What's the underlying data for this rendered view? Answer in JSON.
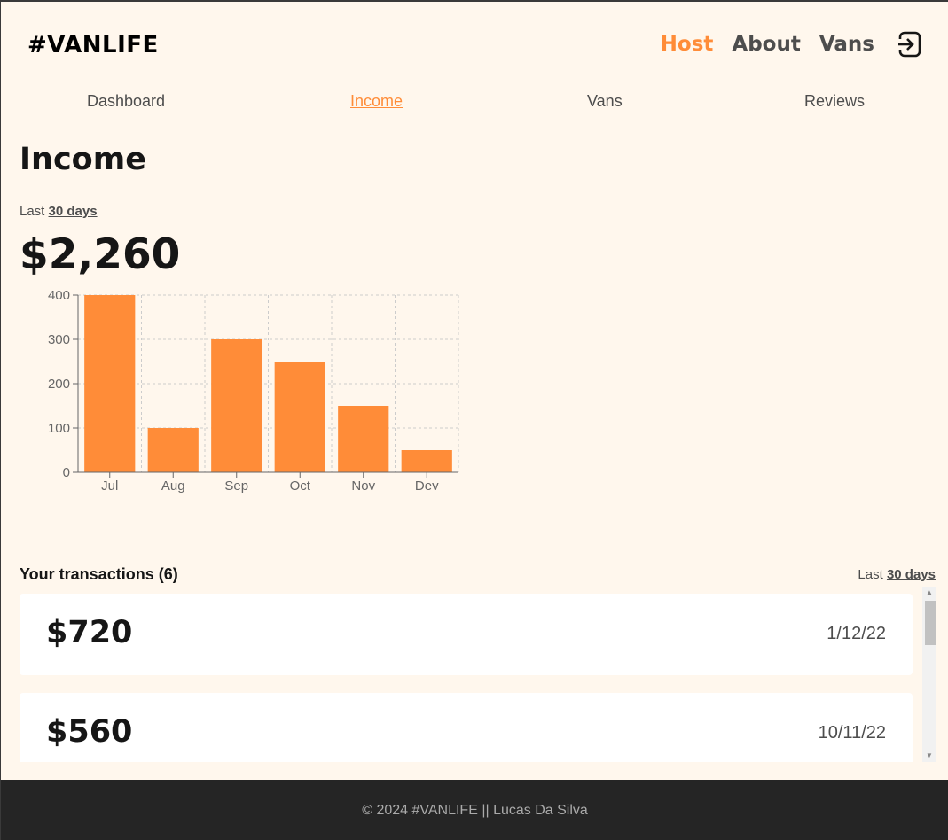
{
  "logo": "#VANLIFE",
  "nav": {
    "host": "Host",
    "about": "About",
    "vans": "Vans"
  },
  "subnav": {
    "dashboard": "Dashboard",
    "income": "Income",
    "vans": "Vans",
    "reviews": "Reviews"
  },
  "colors": {
    "accent": "#ff8c38",
    "background": "#fff7ed",
    "footer": "#252525"
  },
  "icons": {
    "logout": "logout-icon"
  },
  "income": {
    "title": "Income",
    "range_prefix": "Last",
    "range_days": "30 days",
    "total": "$2,260"
  },
  "chart_data": {
    "type": "bar",
    "categories": [
      "Jul",
      "Aug",
      "Sep",
      "Oct",
      "Nov",
      "Dev"
    ],
    "values": [
      400,
      100,
      300,
      250,
      150,
      50
    ],
    "ylim": [
      0,
      400
    ],
    "yticks": [
      0,
      100,
      200,
      300,
      400
    ],
    "grid": true,
    "bar_color": "#ff8c38"
  },
  "transactions": {
    "title": "Your transactions (6)",
    "range_prefix": "Last",
    "range_days": "30 days",
    "items": [
      {
        "amount": "$720",
        "date": "1/12/22"
      },
      {
        "amount": "$560",
        "date": "10/11/22"
      }
    ]
  },
  "footer": {
    "text": "© 2024 #VANLIFE || Lucas Da Silva"
  }
}
